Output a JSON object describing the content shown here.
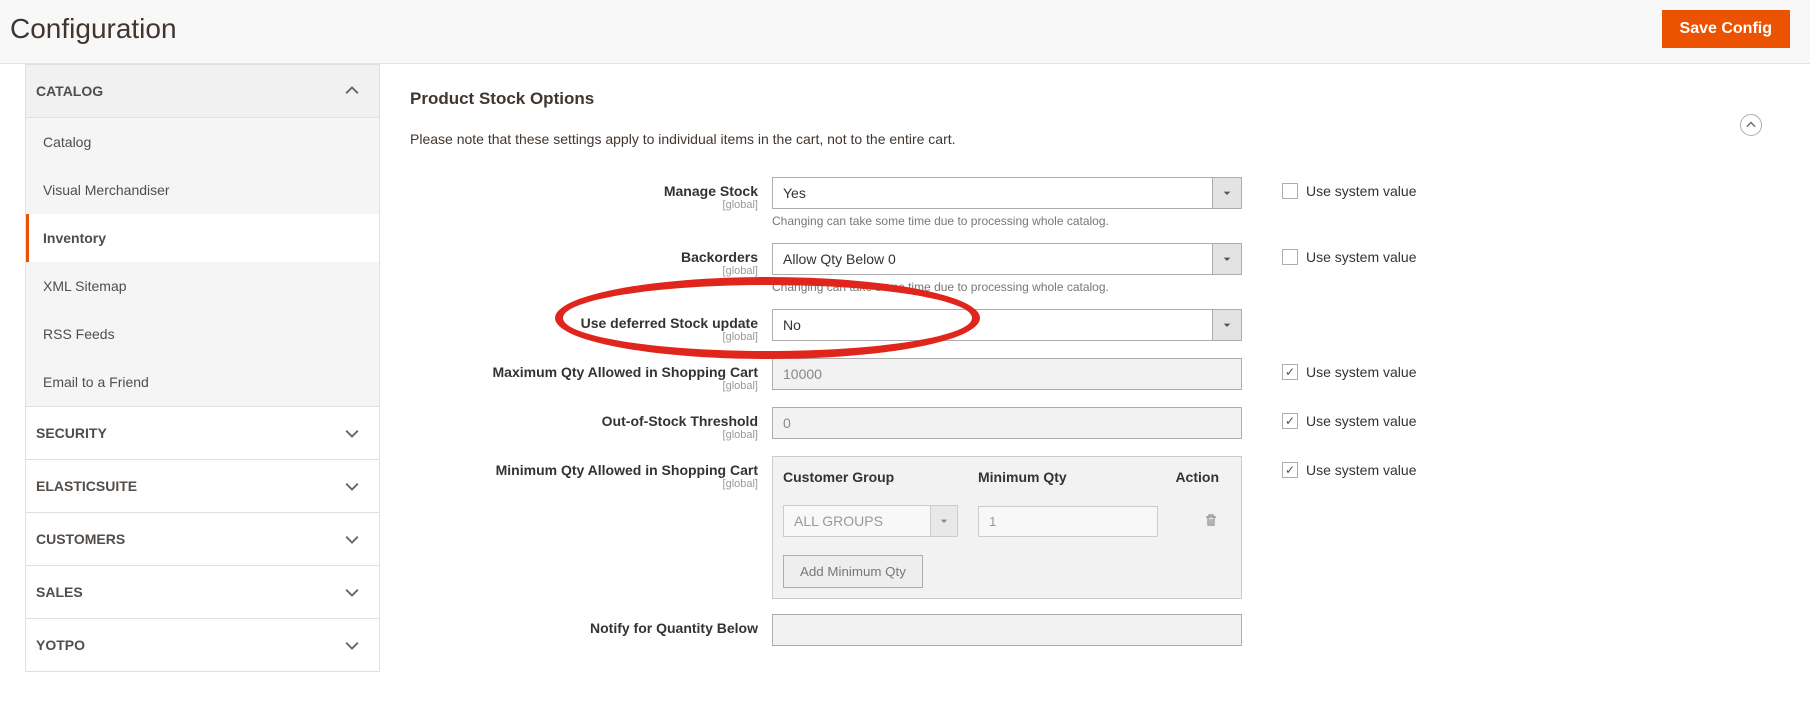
{
  "header": {
    "title": "Configuration",
    "save_label": "Save Config"
  },
  "sidebar": {
    "catalog_label": "CATALOG",
    "items": [
      {
        "label": "Catalog"
      },
      {
        "label": "Visual Merchandiser"
      },
      {
        "label": "Inventory"
      },
      {
        "label": "XML Sitemap"
      },
      {
        "label": "RSS Feeds"
      },
      {
        "label": "Email to a Friend"
      }
    ],
    "groups": [
      {
        "label": "SECURITY"
      },
      {
        "label": "ELASTICSUITE"
      },
      {
        "label": "CUSTOMERS"
      },
      {
        "label": "SALES"
      },
      {
        "label": "YOTPO"
      }
    ]
  },
  "section": {
    "title": "Product Stock Options",
    "note": "Please note that these settings apply to individual items in the cart, not to the entire cart."
  },
  "scope": "[global]",
  "sys_label": "Use system value",
  "fields": {
    "manage_stock": {
      "label": "Manage Stock",
      "value": "Yes",
      "hint": "Changing can take some time due to processing whole catalog."
    },
    "backorders": {
      "label": "Backorders",
      "value": "Allow Qty Below 0",
      "hint": "Changing can take some time due to processing whole catalog."
    },
    "deferred": {
      "label": "Use deferred Stock update",
      "value": "No"
    },
    "max_qty": {
      "label": "Maximum Qty Allowed in Shopping Cart",
      "value": "10000"
    },
    "oos_threshold": {
      "label": "Out-of-Stock Threshold",
      "value": "0"
    },
    "min_qty": {
      "label": "Minimum Qty Allowed in Shopping Cart",
      "th_group": "Customer Group",
      "th_minqty": "Minimum Qty",
      "th_action": "Action",
      "row_group": "ALL GROUPS",
      "row_qty": "1",
      "add_label": "Add Minimum Qty"
    },
    "notify_below": {
      "label": "Notify for Quantity Below"
    }
  }
}
